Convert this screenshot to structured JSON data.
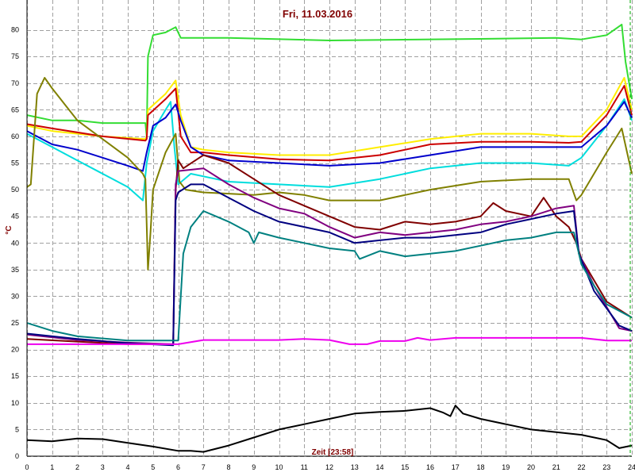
{
  "chart_data": {
    "type": "line",
    "title": "Fri, 11.03.2016",
    "xlabel": "Zeit [23:58]",
    "ylabel": "°C",
    "xlim": [
      0,
      24
    ],
    "ylim": [
      0,
      85
    ],
    "xticks": [
      0,
      1,
      2,
      3,
      4,
      5,
      6,
      7,
      8,
      9,
      10,
      11,
      12,
      13,
      14,
      15,
      16,
      17,
      18,
      19,
      20,
      21,
      22,
      23,
      24
    ],
    "yticks": [
      0,
      5,
      10,
      15,
      20,
      25,
      30,
      35,
      40,
      45,
      50,
      55,
      60,
      65,
      70,
      75,
      80
    ],
    "grid": true,
    "series": [
      {
        "color": "#33dd33",
        "points": [
          [
            0,
            64
          ],
          [
            1,
            63
          ],
          [
            2,
            63
          ],
          [
            3,
            62.5
          ],
          [
            4,
            62.5
          ],
          [
            4.7,
            62.5
          ],
          [
            4.75,
            60
          ],
          [
            4.8,
            75
          ],
          [
            5,
            79
          ],
          [
            5.5,
            79.5
          ],
          [
            5.9,
            80.5
          ],
          [
            6.1,
            78.5
          ],
          [
            8,
            78.5
          ],
          [
            12,
            78
          ],
          [
            18,
            78.3
          ],
          [
            21,
            78.5
          ],
          [
            22,
            78.2
          ],
          [
            23,
            79
          ],
          [
            23.6,
            81
          ],
          [
            23.75,
            74
          ],
          [
            24,
            67
          ]
        ]
      },
      {
        "color": "#ffee00",
        "points": [
          [
            0,
            62
          ],
          [
            1,
            61
          ],
          [
            3,
            60
          ],
          [
            4.7,
            59.5
          ],
          [
            4.75,
            60
          ],
          [
            4.8,
            65
          ],
          [
            5.5,
            68
          ],
          [
            5.9,
            70.5
          ],
          [
            6.1,
            64
          ],
          [
            6.5,
            58
          ],
          [
            7,
            57.5
          ],
          [
            8,
            57
          ],
          [
            10,
            56.5
          ],
          [
            12,
            56.5
          ],
          [
            14,
            58
          ],
          [
            16,
            59.5
          ],
          [
            18,
            60.5
          ],
          [
            20,
            60.5
          ],
          [
            21.5,
            60
          ],
          [
            22,
            60
          ],
          [
            23,
            65
          ],
          [
            23.7,
            71
          ],
          [
            24,
            65
          ]
        ]
      },
      {
        "color": "#cc0000",
        "points": [
          [
            0,
            62.3
          ],
          [
            1,
            61.5
          ],
          [
            3,
            60
          ],
          [
            4.7,
            59.2
          ],
          [
            4.75,
            59.5
          ],
          [
            4.8,
            64
          ],
          [
            5.5,
            67
          ],
          [
            5.9,
            69
          ],
          [
            6.1,
            60
          ],
          [
            6.5,
            57
          ],
          [
            7,
            57
          ],
          [
            8,
            56.5
          ],
          [
            10,
            55.7
          ],
          [
            12,
            55.5
          ],
          [
            14,
            56.5
          ],
          [
            16,
            58.5
          ],
          [
            18,
            59
          ],
          [
            20,
            59
          ],
          [
            21.5,
            58.8
          ],
          [
            22,
            59
          ],
          [
            23,
            64
          ],
          [
            23.7,
            69.5
          ],
          [
            24,
            64
          ]
        ]
      },
      {
        "color": "#00dddd",
        "points": [
          [
            0,
            60.5
          ],
          [
            1,
            58
          ],
          [
            2,
            55.5
          ],
          [
            3,
            53
          ],
          [
            4,
            50.5
          ],
          [
            4.6,
            48
          ],
          [
            4.75,
            55
          ],
          [
            5,
            61
          ],
          [
            5.5,
            65
          ],
          [
            5.7,
            66.5
          ],
          [
            5.85,
            58
          ],
          [
            6,
            51
          ],
          [
            6.5,
            53
          ],
          [
            7,
            52.5
          ],
          [
            8,
            51.5
          ],
          [
            10,
            51
          ],
          [
            12,
            50.5
          ],
          [
            14,
            52
          ],
          [
            16,
            54
          ],
          [
            18,
            55
          ],
          [
            20,
            55
          ],
          [
            21.5,
            54.5
          ],
          [
            22,
            56
          ],
          [
            23,
            62
          ],
          [
            23.7,
            67
          ],
          [
            24,
            63
          ]
        ]
      },
      {
        "color": "#0000cc",
        "points": [
          [
            0,
            61
          ],
          [
            1,
            58.5
          ],
          [
            2,
            57.5
          ],
          [
            3,
            56
          ],
          [
            4,
            54.5
          ],
          [
            4.6,
            53.5
          ],
          [
            4.75,
            57
          ],
          [
            5,
            62
          ],
          [
            5.5,
            63.5
          ],
          [
            5.9,
            66
          ],
          [
            6.1,
            63
          ],
          [
            6.5,
            58
          ],
          [
            7,
            56.5
          ],
          [
            8,
            55.5
          ],
          [
            10,
            55
          ],
          [
            12,
            54.5
          ],
          [
            14,
            55
          ],
          [
            16,
            56.5
          ],
          [
            18,
            58
          ],
          [
            20,
            58
          ],
          [
            21.5,
            58
          ],
          [
            22,
            58
          ],
          [
            23,
            62
          ],
          [
            23.7,
            66.5
          ],
          [
            24,
            63.5
          ]
        ]
      },
      {
        "color": "#808000",
        "points": [
          [
            0,
            50.5
          ],
          [
            0.15,
            51
          ],
          [
            0.4,
            68
          ],
          [
            0.7,
            71
          ],
          [
            1,
            69
          ],
          [
            1.5,
            66
          ],
          [
            2,
            63
          ],
          [
            3,
            59.5
          ],
          [
            4,
            56
          ],
          [
            4.6,
            53
          ],
          [
            4.7,
            52
          ],
          [
            4.8,
            35
          ],
          [
            4.9,
            42
          ],
          [
            5,
            50
          ],
          [
            5.5,
            57
          ],
          [
            5.9,
            60.5
          ],
          [
            6.05,
            51.5
          ],
          [
            6.3,
            50
          ],
          [
            7,
            49.5
          ],
          [
            9,
            49
          ],
          [
            10,
            49.5
          ],
          [
            11,
            49
          ],
          [
            12,
            48
          ],
          [
            13,
            48
          ],
          [
            14,
            48
          ],
          [
            15,
            49
          ],
          [
            16,
            50
          ],
          [
            18,
            51.5
          ],
          [
            20,
            52
          ],
          [
            21.5,
            52
          ],
          [
            21.8,
            48
          ],
          [
            22,
            49
          ],
          [
            23,
            57
          ],
          [
            23.6,
            61.5
          ],
          [
            24,
            53
          ]
        ]
      },
      {
        "color": "#800000",
        "points": [
          [
            0,
            22
          ],
          [
            2,
            21.5
          ],
          [
            4,
            21
          ],
          [
            5.8,
            21
          ],
          [
            5.9,
            50
          ],
          [
            6,
            55.5
          ],
          [
            6.2,
            54
          ],
          [
            7,
            56.5
          ],
          [
            8,
            55
          ],
          [
            9,
            52
          ],
          [
            10,
            49
          ],
          [
            11,
            47
          ],
          [
            12,
            45
          ],
          [
            13,
            43
          ],
          [
            14,
            42.5
          ],
          [
            15,
            44
          ],
          [
            16,
            43.5
          ],
          [
            17,
            44
          ],
          [
            18,
            45
          ],
          [
            18.5,
            47.5
          ],
          [
            19,
            46
          ],
          [
            20,
            45
          ],
          [
            20.5,
            48.5
          ],
          [
            21,
            45
          ],
          [
            21.5,
            43
          ],
          [
            21.8,
            40
          ],
          [
            22,
            37
          ],
          [
            23,
            29
          ],
          [
            24,
            26
          ]
        ]
      },
      {
        "color": "#800080",
        "points": [
          [
            0,
            22.8
          ],
          [
            2,
            21.8
          ],
          [
            4,
            21.3
          ],
          [
            5.8,
            21
          ],
          [
            5.9,
            51
          ],
          [
            6,
            53.5
          ],
          [
            7,
            54
          ],
          [
            8,
            51
          ],
          [
            9,
            48.5
          ],
          [
            10,
            46.5
          ],
          [
            11,
            45.5
          ],
          [
            12,
            43
          ],
          [
            13,
            41
          ],
          [
            14,
            42
          ],
          [
            15,
            41.5
          ],
          [
            16,
            42
          ],
          [
            17,
            42.5
          ],
          [
            18,
            43.5
          ],
          [
            19,
            44
          ],
          [
            20,
            45
          ],
          [
            21,
            46.5
          ],
          [
            21.7,
            47
          ],
          [
            21.9,
            38
          ],
          [
            22.5,
            32
          ],
          [
            23.5,
            24
          ],
          [
            24,
            23.5
          ]
        ]
      },
      {
        "color": "#000080",
        "points": [
          [
            0,
            23
          ],
          [
            2,
            22
          ],
          [
            4,
            21.2
          ],
          [
            5.8,
            20.8
          ],
          [
            5.9,
            48
          ],
          [
            6,
            49.5
          ],
          [
            6.5,
            51
          ],
          [
            7,
            51
          ],
          [
            8,
            48.5
          ],
          [
            9,
            46
          ],
          [
            10,
            44
          ],
          [
            11,
            43
          ],
          [
            12,
            42
          ],
          [
            13,
            40
          ],
          [
            14,
            40.5
          ],
          [
            15,
            41
          ],
          [
            16,
            41
          ],
          [
            17,
            41.5
          ],
          [
            18,
            42
          ],
          [
            19,
            43.5
          ],
          [
            20,
            44.5
          ],
          [
            21,
            45.5
          ],
          [
            21.7,
            46
          ],
          [
            21.9,
            38
          ],
          [
            22.5,
            31
          ],
          [
            23.5,
            24.5
          ],
          [
            24,
            23.5
          ]
        ]
      },
      {
        "color": "#008080",
        "points": [
          [
            0,
            25
          ],
          [
            1,
            23.5
          ],
          [
            2,
            22.5
          ],
          [
            4,
            21.7
          ],
          [
            6,
            21.7
          ],
          [
            6.2,
            38
          ],
          [
            6.5,
            43
          ],
          [
            7,
            46
          ],
          [
            7.5,
            45
          ],
          [
            8,
            44
          ],
          [
            8.8,
            42
          ],
          [
            9,
            40
          ],
          [
            9.2,
            42
          ],
          [
            10,
            41
          ],
          [
            11,
            40
          ],
          [
            12,
            39
          ],
          [
            13,
            38.5
          ],
          [
            13.2,
            37
          ],
          [
            14,
            38.5
          ],
          [
            15,
            37.5
          ],
          [
            16,
            38
          ],
          [
            17,
            38.5
          ],
          [
            18,
            39.5
          ],
          [
            19,
            40.5
          ],
          [
            20,
            41
          ],
          [
            21,
            42
          ],
          [
            21.7,
            42
          ],
          [
            22,
            36
          ],
          [
            22.5,
            32
          ],
          [
            23,
            28.5
          ],
          [
            24,
            26
          ]
        ]
      },
      {
        "color": "#ee00ee",
        "points": [
          [
            0,
            21
          ],
          [
            4,
            21
          ],
          [
            6,
            21
          ],
          [
            7,
            21.8
          ],
          [
            10,
            21.8
          ],
          [
            11,
            22
          ],
          [
            12,
            21.8
          ],
          [
            12.8,
            21
          ],
          [
            13.5,
            21
          ],
          [
            14,
            21.6
          ],
          [
            15,
            21.6
          ],
          [
            15.5,
            22.2
          ],
          [
            16,
            21.8
          ],
          [
            17,
            22.2
          ],
          [
            19,
            22.2
          ],
          [
            21,
            22.2
          ],
          [
            22,
            22.2
          ],
          [
            23,
            21.7
          ],
          [
            24,
            21.7
          ]
        ]
      },
      {
        "color": "#000000",
        "points": [
          [
            0,
            3
          ],
          [
            1,
            2.8
          ],
          [
            2,
            3.3
          ],
          [
            3,
            3.2
          ],
          [
            4,
            2.5
          ],
          [
            5,
            1.8
          ],
          [
            6,
            1
          ],
          [
            6.5,
            1
          ],
          [
            7,
            0.8
          ],
          [
            8,
            2
          ],
          [
            9,
            3.5
          ],
          [
            10,
            5
          ],
          [
            11,
            6
          ],
          [
            12,
            7
          ],
          [
            13,
            8
          ],
          [
            14,
            8.3
          ],
          [
            15,
            8.5
          ],
          [
            16,
            9
          ],
          [
            16.5,
            8.2
          ],
          [
            16.8,
            7.5
          ],
          [
            17,
            9.5
          ],
          [
            17.3,
            8
          ],
          [
            18,
            7
          ],
          [
            19,
            6
          ],
          [
            20,
            5
          ],
          [
            21,
            4.5
          ],
          [
            22,
            4
          ],
          [
            23,
            3
          ],
          [
            23.5,
            1.5
          ],
          [
            24,
            2
          ]
        ]
      }
    ]
  }
}
